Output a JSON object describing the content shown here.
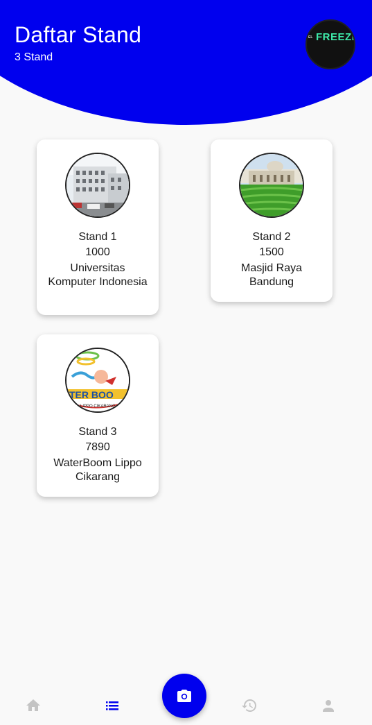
{
  "header": {
    "title": "Daftar Stand",
    "subtitle": "3 Stand",
    "avatar_text": "FREEZE"
  },
  "stands": [
    {
      "name": "Stand 1",
      "number": "1000",
      "location": "Universitas Komputer Indonesia",
      "thumb_icon": "building-photo"
    },
    {
      "name": "Stand 2",
      "number": "1500",
      "location": "Masjid Raya Bandung",
      "thumb_icon": "mosque-photo"
    },
    {
      "name": "Stand 3",
      "number": "7890",
      "location": "WaterBoom Lippo Cikarang",
      "thumb_icon": "waterboom-logo"
    }
  ],
  "bottom_nav": {
    "items": [
      "home-icon",
      "list-icon",
      "camera-icon",
      "history-icon",
      "profile-icon"
    ],
    "active": "list-icon"
  },
  "colors": {
    "primary": "#0000ee",
    "background": "#f9f9f9",
    "nav_inactive": "#c4c4c4",
    "nav_active": "#0000ee"
  }
}
